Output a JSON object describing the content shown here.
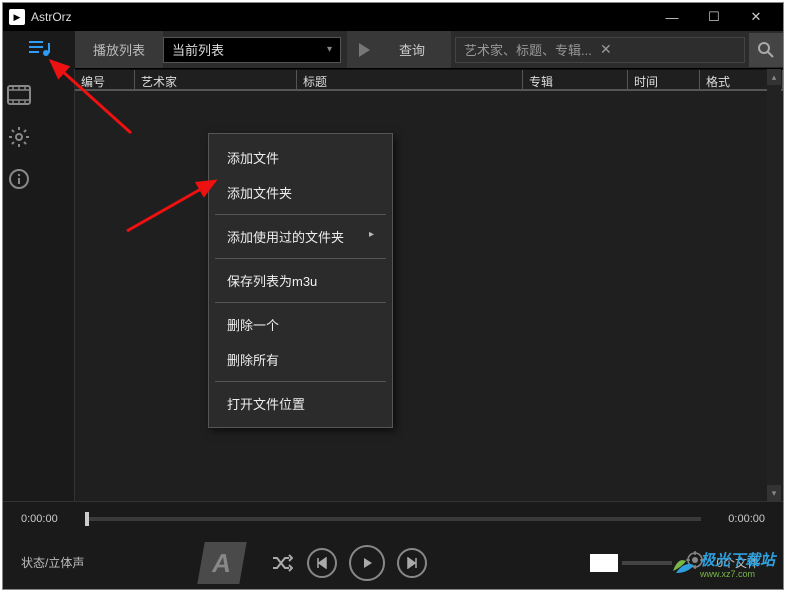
{
  "titlebar": {
    "title": "AstrOrz"
  },
  "toolbar": {
    "playlist_label": "播放列表",
    "dropdown_value": "当前列表",
    "query_label": "查询",
    "search_placeholder": "艺术家、标题、专辑..."
  },
  "columns": {
    "c1": "编号",
    "c2": "艺术家",
    "c3": "标题",
    "c4": "专辑",
    "c5": "时间",
    "c6": "格式"
  },
  "context_menu": {
    "add_file": "添加文件",
    "add_folder": "添加文件夹",
    "add_used_folder": "添加使用过的文件夹",
    "save_m3u": "保存列表为m3u",
    "delete_one": "删除一个",
    "delete_all": "删除所有",
    "open_location": "打开文件位置"
  },
  "player": {
    "time_left": "0:00:00",
    "time_right": "0:00:00",
    "status": "状态/立体声",
    "file_count": "0个文件"
  },
  "watermark": {
    "brand": "极光下载站",
    "domain": "www.xz7.com"
  }
}
